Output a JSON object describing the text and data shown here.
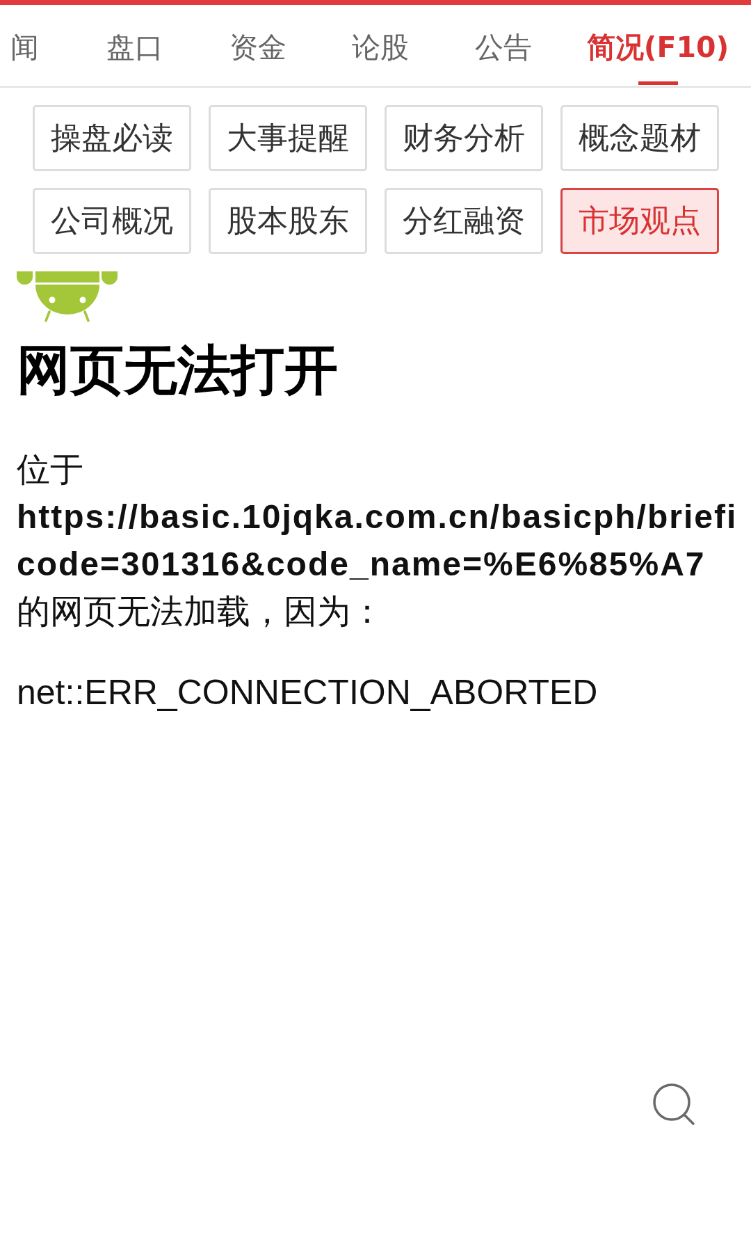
{
  "tabs": [
    {
      "label": "闻",
      "selected": false
    },
    {
      "label": "盘口",
      "selected": false
    },
    {
      "label": "资金",
      "selected": false
    },
    {
      "label": "论股",
      "selected": false
    },
    {
      "label": "公告",
      "selected": false
    },
    {
      "label": "简况(F10)",
      "selected": true
    }
  ],
  "sub_tabs": [
    {
      "label": "操盘必读",
      "selected": false
    },
    {
      "label": "大事提醒",
      "selected": false
    },
    {
      "label": "财务分析",
      "selected": false
    },
    {
      "label": "概念题材",
      "selected": false
    },
    {
      "label": "公司概况",
      "selected": false
    },
    {
      "label": "股本股东",
      "selected": false
    },
    {
      "label": "分红融资",
      "selected": false
    },
    {
      "label": "市场观点",
      "selected": true
    }
  ],
  "error_page": {
    "title": "网页无法打开",
    "location_label": "位于",
    "url_lines": [
      "https://basic.10jqka.com.cn/basicph/briefi",
      "code=301316&code_name=%E6%85%A7"
    ],
    "reason_text": "的网页无法加载，因为：",
    "error_code": "net::ERR_CONNECTION_ABORTED"
  }
}
